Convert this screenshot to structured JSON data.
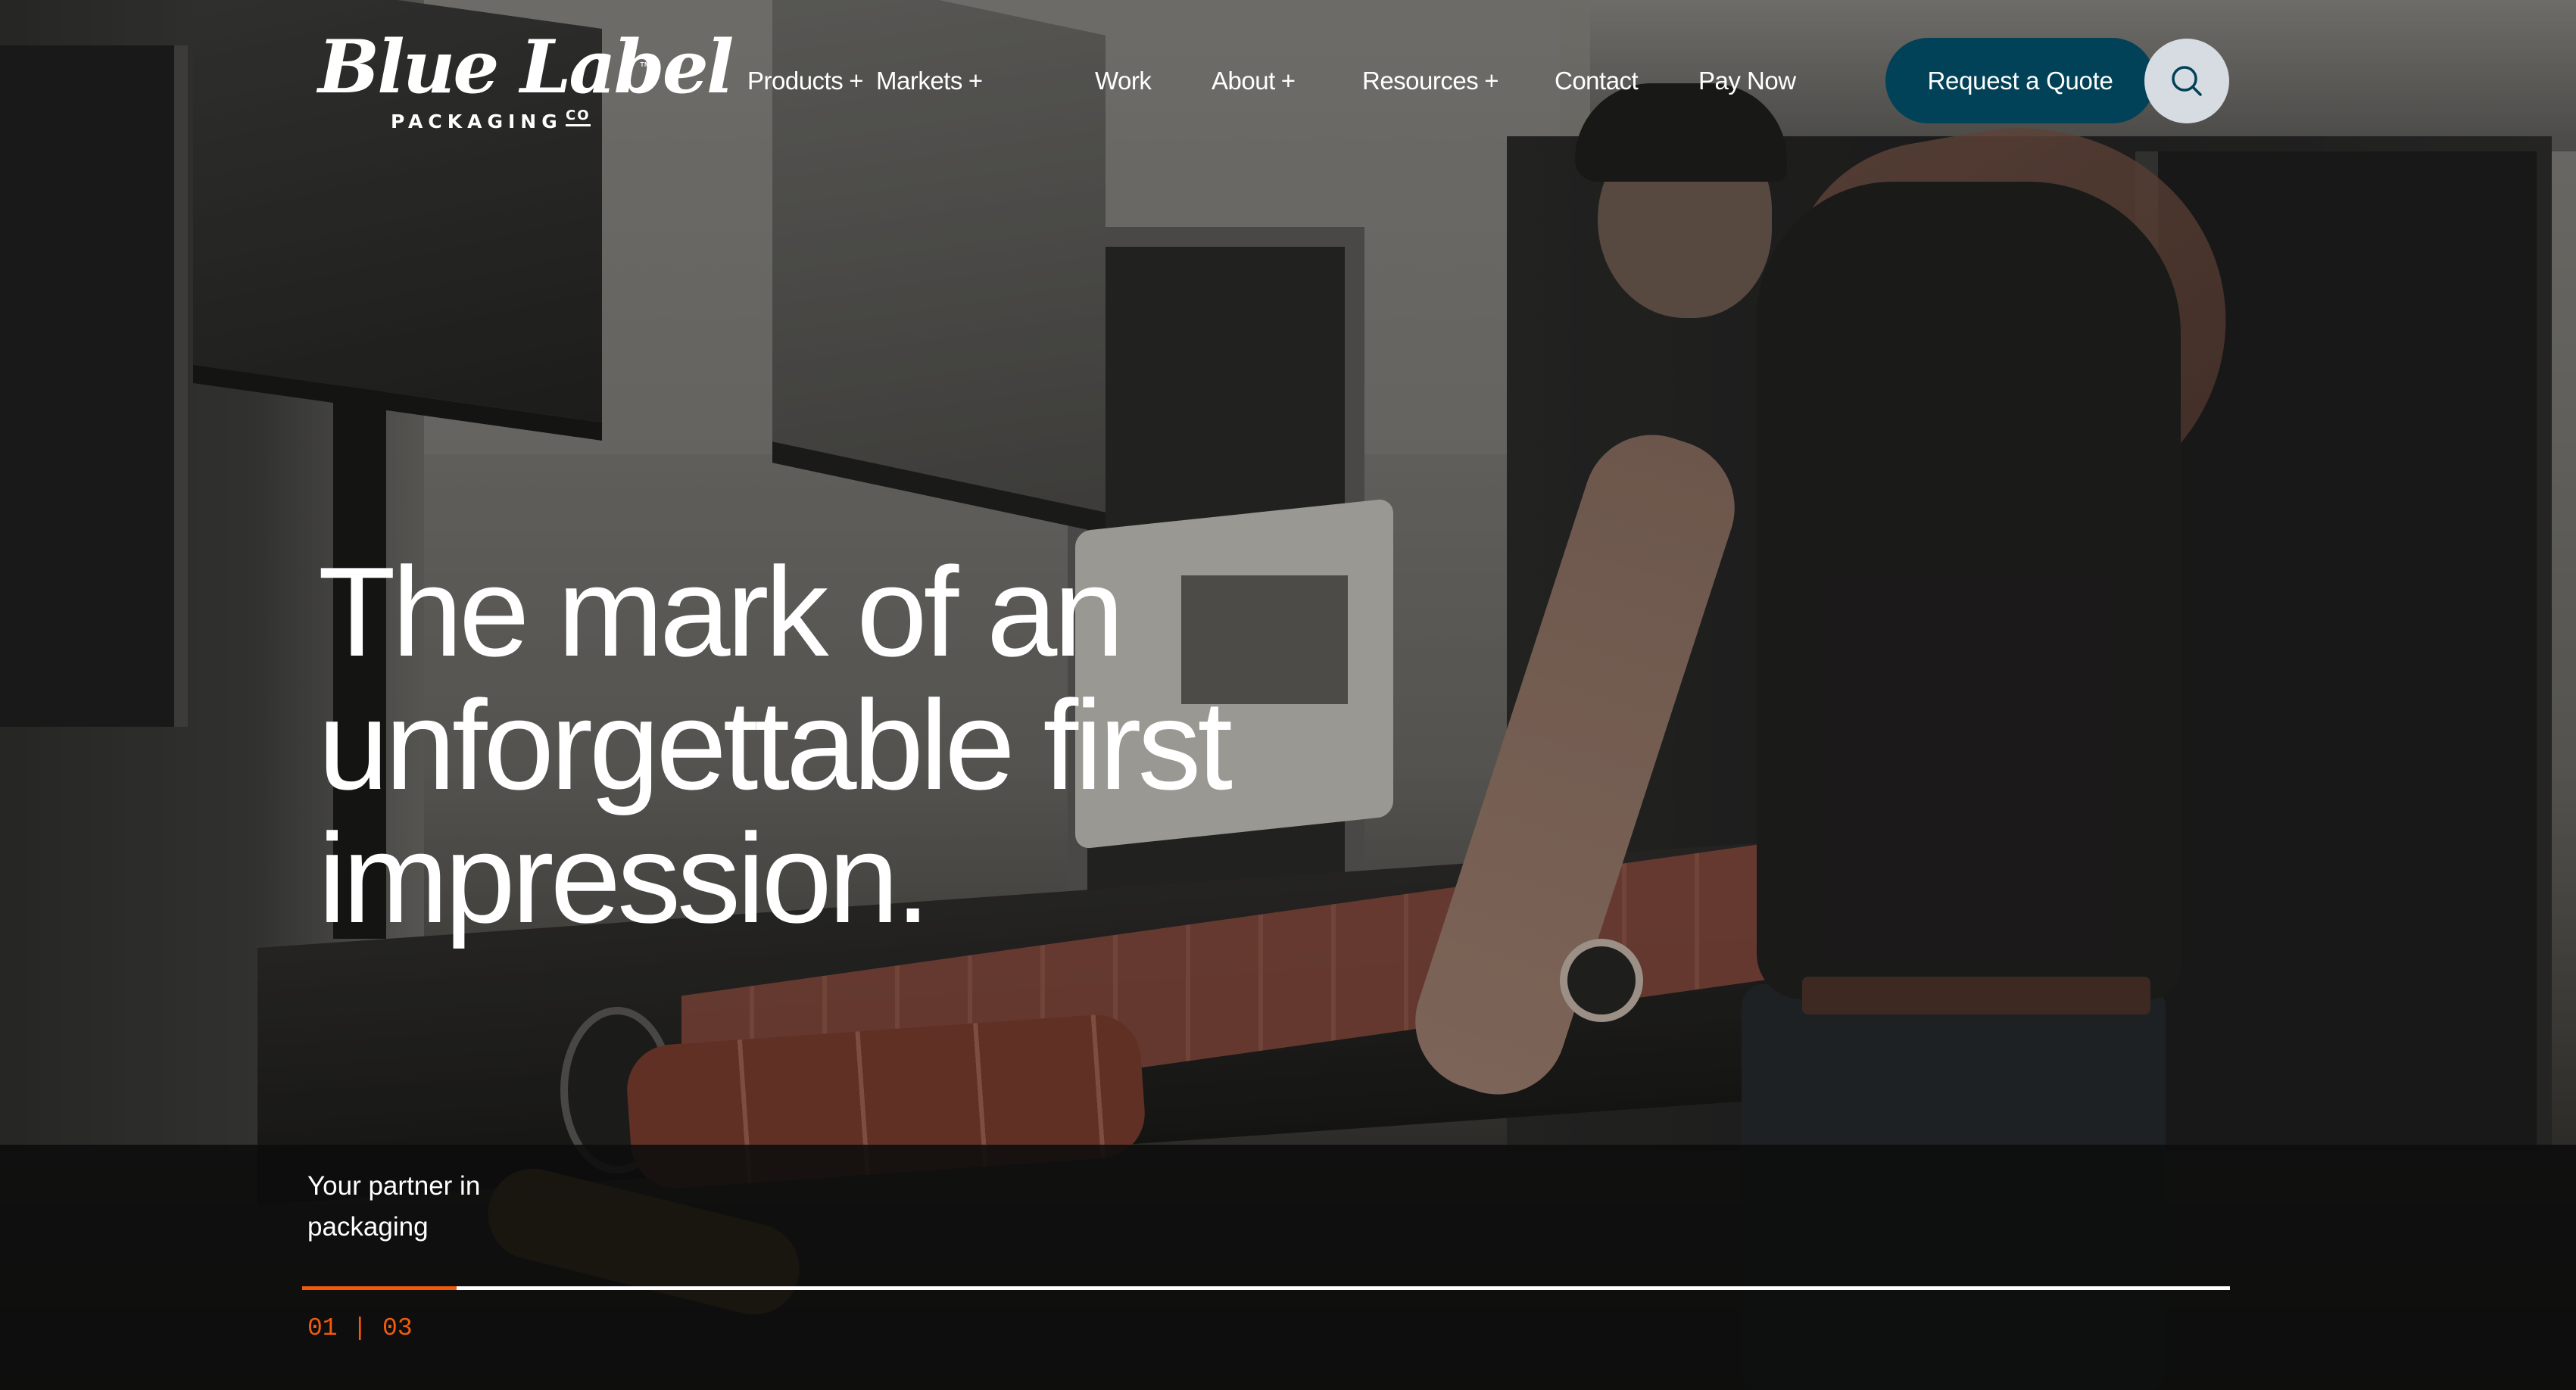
{
  "brand": {
    "name": "Blue Label",
    "trademark": "™",
    "subtitle": "PACKAGING",
    "co": "CO"
  },
  "nav": {
    "items": [
      {
        "label": "Products",
        "has_submenu": true,
        "indicator": "+"
      },
      {
        "label": "Markets",
        "has_submenu": true,
        "indicator": "+"
      },
      {
        "label": "Work",
        "has_submenu": false,
        "indicator": ""
      },
      {
        "label": "About",
        "has_submenu": true,
        "indicator": "+"
      },
      {
        "label": "Resources",
        "has_submenu": true,
        "indicator": "+"
      },
      {
        "label": "Contact",
        "has_submenu": false,
        "indicator": ""
      },
      {
        "label": "Pay Now",
        "has_submenu": false,
        "indicator": ""
      }
    ],
    "cta_label": "Request a Quote",
    "search_icon": "search-icon"
  },
  "hero": {
    "headline_lines": [
      "The mark of an",
      "unforgettable first",
      "impression."
    ],
    "tagline": "Your partner in packaging",
    "slider": {
      "current": "01",
      "separator": "|",
      "total": "03",
      "progress_fraction": 0.08
    }
  },
  "colors": {
    "primary": "#024258",
    "accent": "#f25a0c",
    "search_bg": "#d6dce2",
    "text": "#ffffff"
  }
}
